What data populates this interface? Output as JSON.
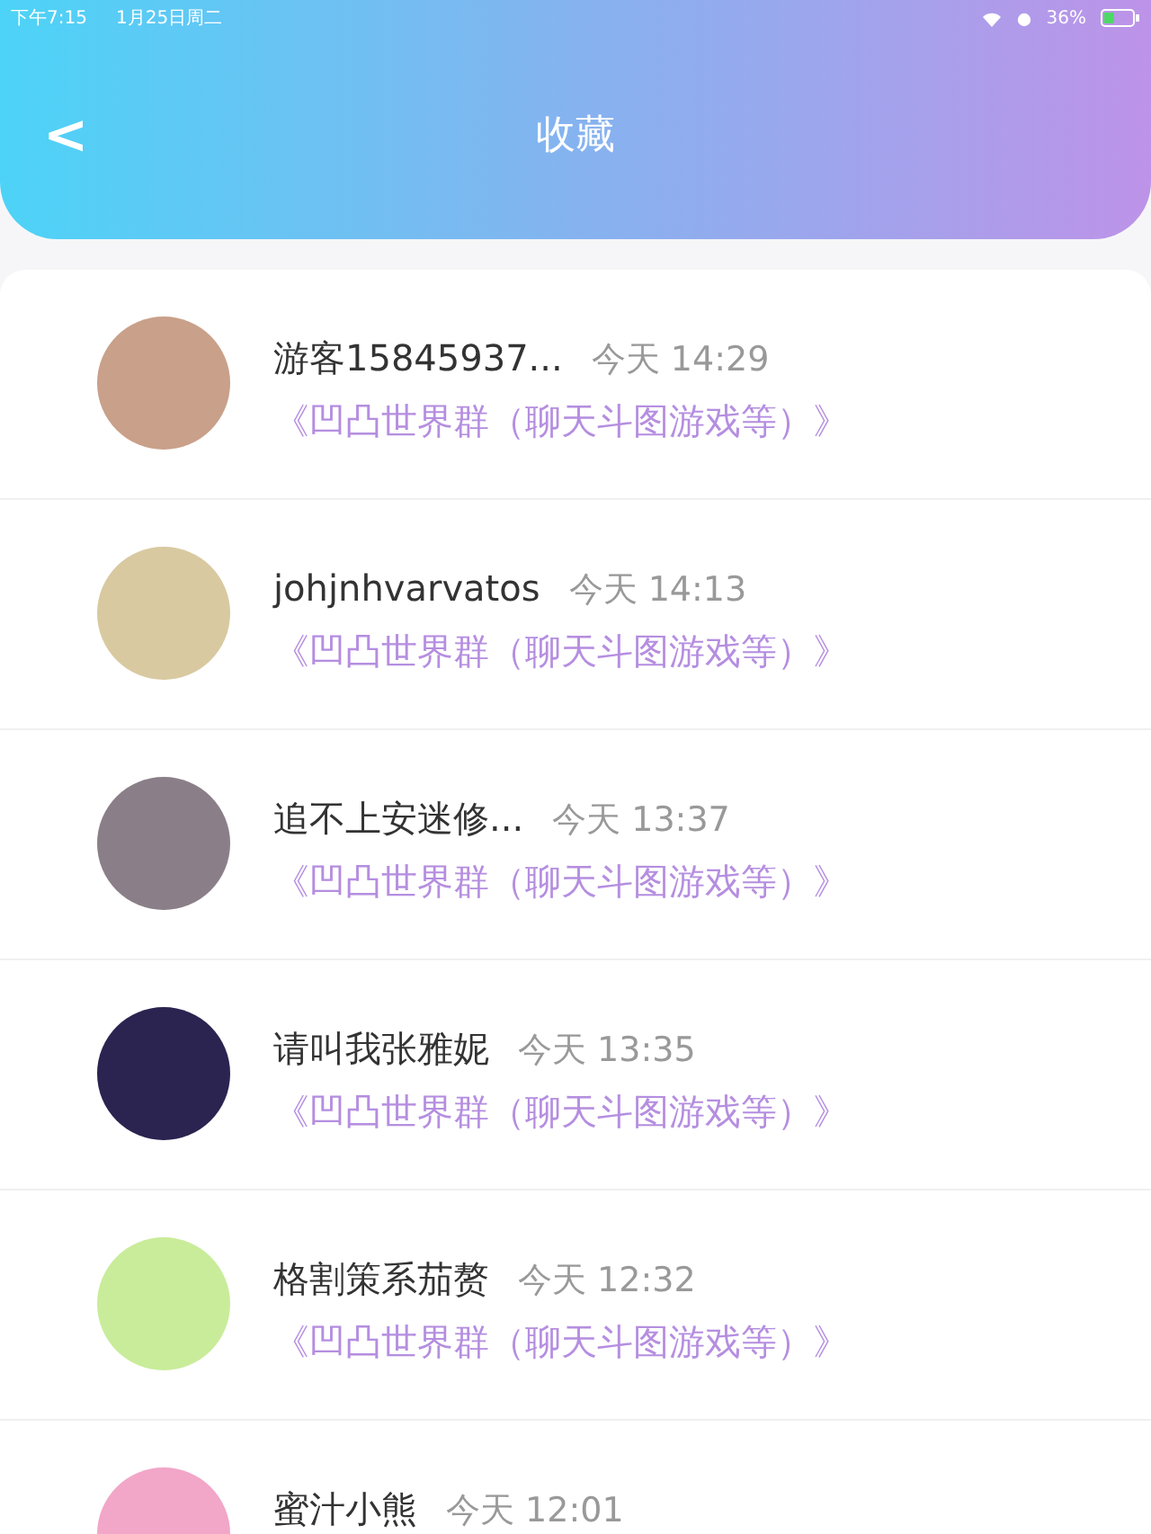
{
  "status_bar": {
    "time": "下午7:15",
    "date": "1月25日周二",
    "battery": "36%"
  },
  "header": {
    "back": "<",
    "title": "收藏"
  },
  "favorites": [
    {
      "name": "游客15845937...",
      "time": "今天 14:29",
      "group": "《凹凸世界群（聊天斗图游戏等）》",
      "color": "#c9a08a"
    },
    {
      "name": "johjnhvarvatos",
      "time": "今天 14:13",
      "group": "《凹凸世界群（聊天斗图游戏等）》",
      "color": "#d8c9a0"
    },
    {
      "name": "追不上安迷修...",
      "time": "今天 13:37",
      "group": "《凹凸世界群（聊天斗图游戏等）》",
      "color": "#8a7f88"
    },
    {
      "name": "请叫我张雅妮",
      "time": "今天 13:35",
      "group": "《凹凸世界群（聊天斗图游戏等）》",
      "color": "#2b2350"
    },
    {
      "name": "格割策系茄赘",
      "time": "今天 12:32",
      "group": "《凹凸世界群（聊天斗图游戏等）》",
      "color": "#c9ec9a"
    },
    {
      "name": "蜜汁小熊",
      "time": "今天 12:01",
      "color": "#f2a6c8"
    }
  ]
}
